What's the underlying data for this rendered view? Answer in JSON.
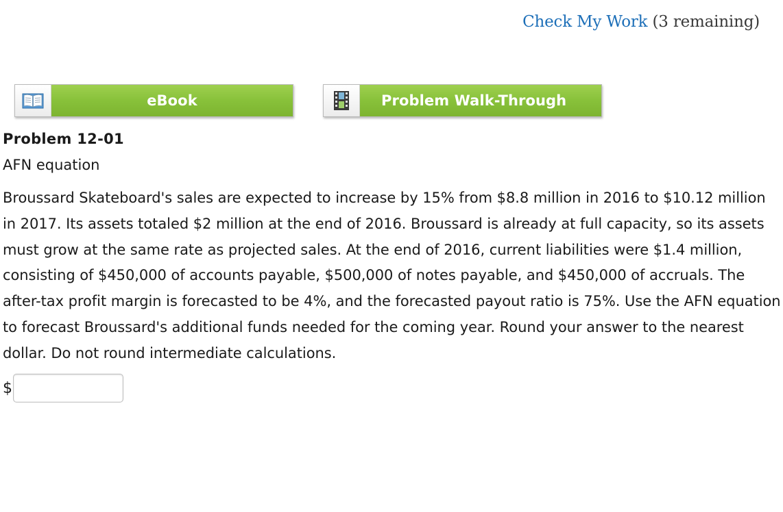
{
  "header": {
    "check_work_label": "Check My Work",
    "remaining_text": "(3 remaining)",
    "link_color": "#1d6fb8"
  },
  "resources": {
    "ebook": {
      "label": "eBook",
      "icon": "book-icon"
    },
    "walkthrough": {
      "label": "Problem Walk-Through",
      "icon": "film-icon"
    },
    "button_color": "#88c13a"
  },
  "problem": {
    "title": "Problem 12-01",
    "subtitle": "AFN equation",
    "body": "Broussard Skateboard's sales are expected to increase by 15% from $8.8 million in 2016 to $10.12 million in 2017. Its assets totaled $2 million at the end of 2016. Broussard is already at full capacity, so its assets must grow at the same rate as projected sales. At the end of 2016, current liabilities were $1.4 million, consisting of $450,000 of accounts payable, $500,000 of notes payable, and $450,000 of accruals. The after-tax profit margin is forecasted to be 4%, and the forecasted payout ratio is 75%. Use the AFN equation to forecast Broussard's additional funds needed for the coming year. Round your answer to the nearest dollar. Do not round intermediate calculations."
  },
  "answer": {
    "currency_symbol": "$",
    "value": ""
  }
}
